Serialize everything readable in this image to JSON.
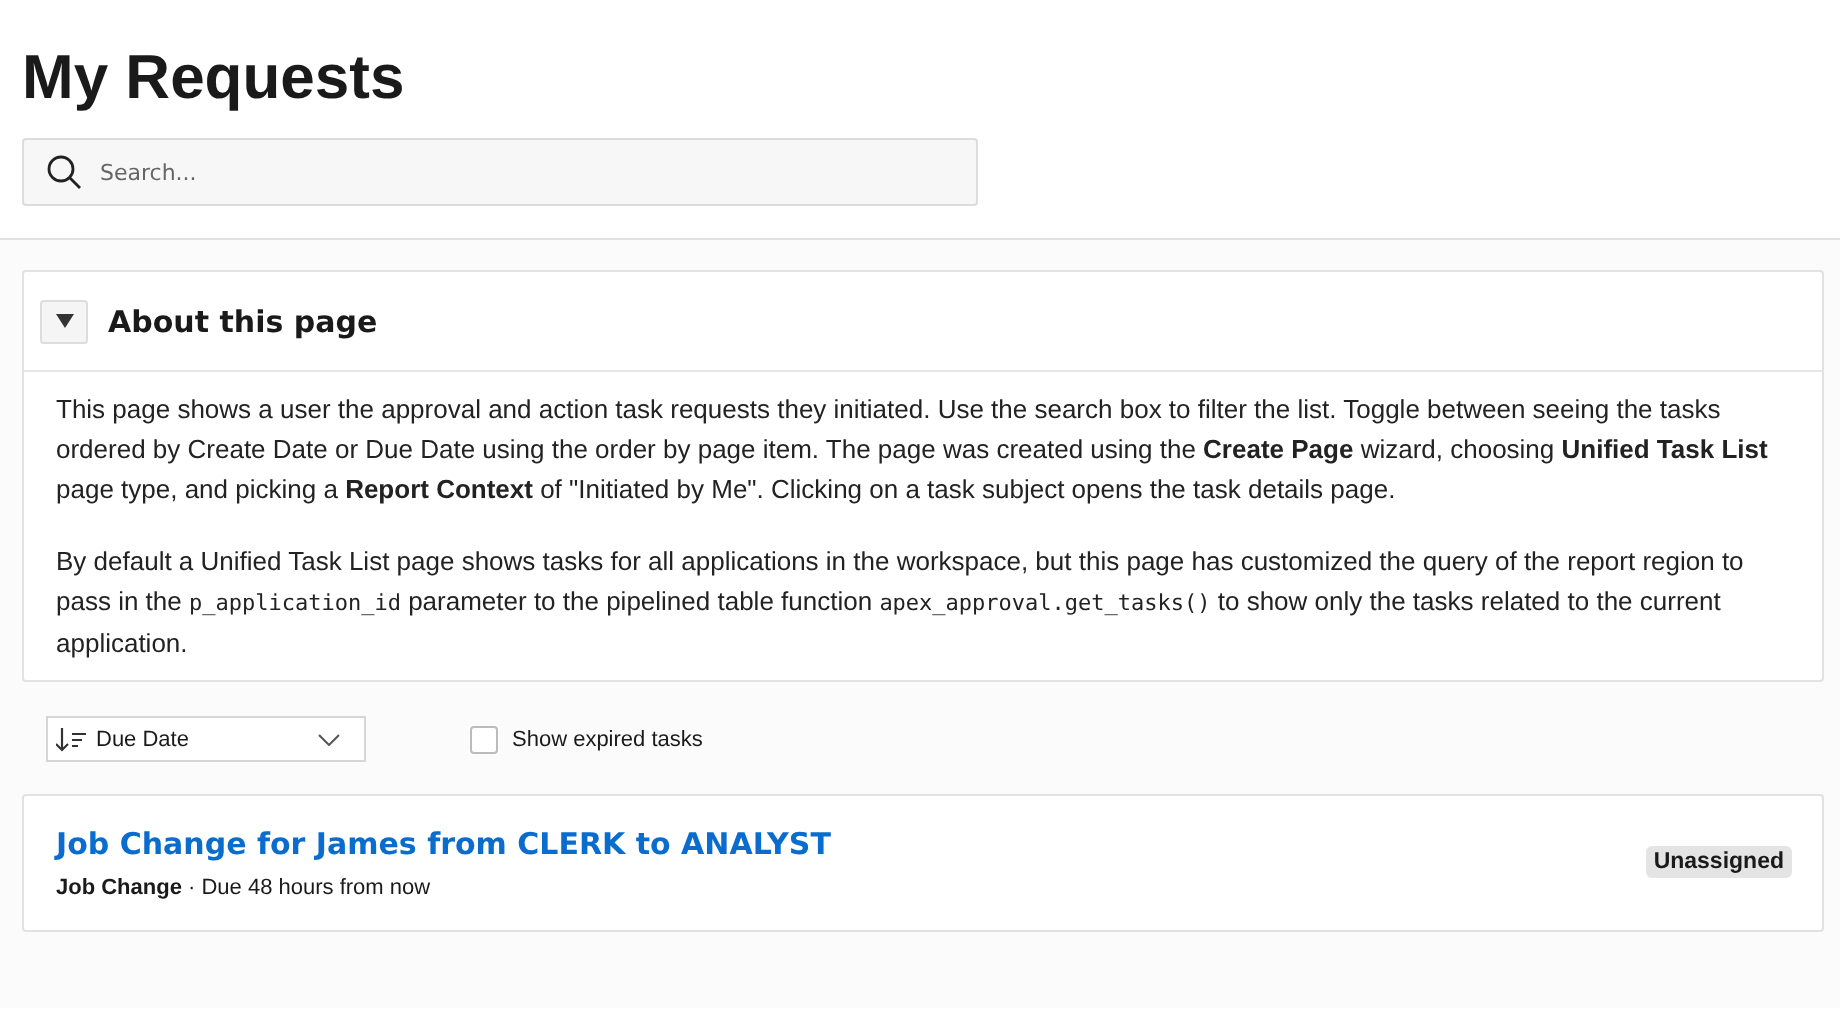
{
  "page_title": "My Requests",
  "search": {
    "placeholder": "Search..."
  },
  "about": {
    "title": "About this page",
    "expanded": true,
    "paragraph_1": "This page shows a user the approval and action task requests they initiated. Use the search box to filter the list. Toggle between seeing the tasks ordered by Create Date or Due Date using the order by page item. The page was created using the **Create Page** wizard, choosing **Unified Task List** page type, and picking a **Report Context** of \"Initiated by Me\". Clicking on a task subject opens the task details page.",
    "paragraph_2": [
      {
        "kind": "text",
        "text": "By default a Unified Task List page shows tasks for all applications in the workspace, but this page has customized the query of the report region to pass in the "
      },
      {
        "kind": "code",
        "text": "p_application_id"
      },
      {
        "kind": "text",
        "text": " parameter to the pipelined table function "
      },
      {
        "kind": "code",
        "text": "apex_approval.get_tasks()"
      },
      {
        "kind": "text",
        "text": " to show only the tasks related to the current application."
      }
    ]
  },
  "sort": {
    "value": "Due Date"
  },
  "show_expired": {
    "label": "Show expired tasks",
    "checked": false
  },
  "tasks": [
    {
      "subject": "Job Change for James from CLERK to ANALYST",
      "type": "Job Change",
      "due": " · Due 48 hours from now",
      "badge": "Unassigned"
    }
  ]
}
